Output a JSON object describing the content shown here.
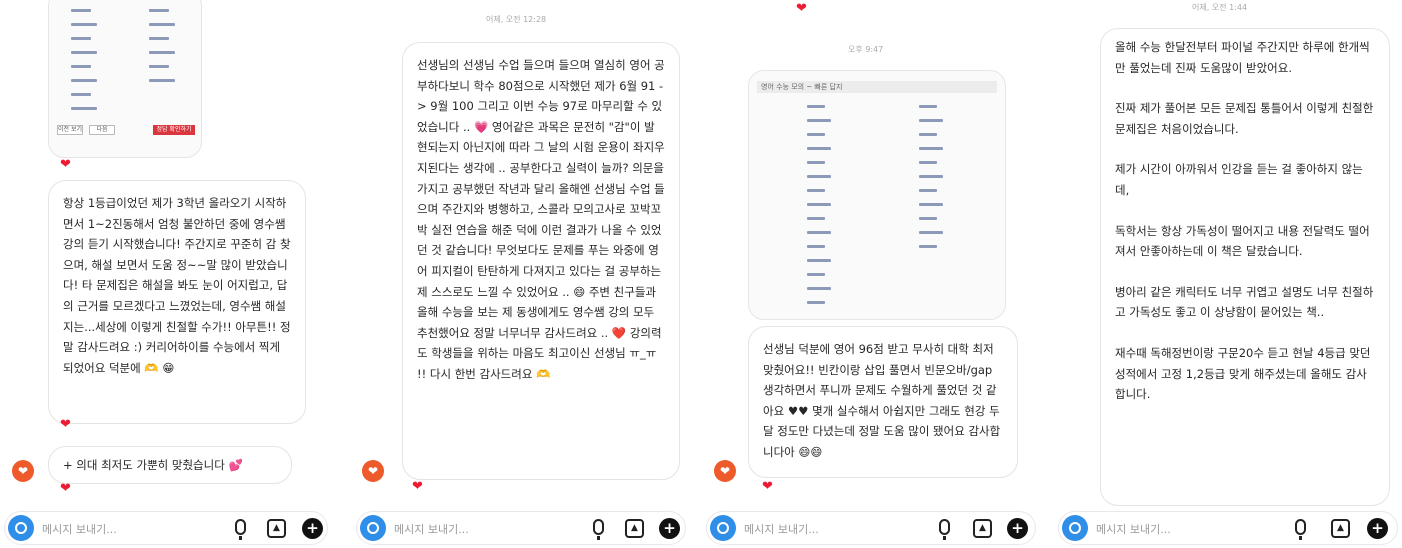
{
  "composer": {
    "placeholder": "메시지 보내기..."
  },
  "icons": {
    "heart": "heart-icon",
    "camera": "camera-icon",
    "mic": "microphone-icon",
    "gallery": "image-icon",
    "plus": "plus-circle-icon",
    "reaction": "heart-reaction-icon"
  },
  "colors": {
    "reaction_button": "#ee5a2a",
    "heart": "#ed1c33",
    "camera": "#2f8fe8"
  },
  "panel1": {
    "card": {
      "btn_a": "이전 보기",
      "btn_b": "다음",
      "btn_red": "정답 확인하기"
    },
    "msg1": "항상 1등급이었던 제가 3학년 올라오기 시작하면서 1~2진동해서 엄청 불안하던 중에 영수쌤 강의 듣기 시작했습니다! 주간지로 꾸준히 감 찾으며, 해설 보면서 도움 정~~말 많이 받았습니다! 타 문제집은 해설을 봐도 눈이 어지럽고, 답의 근거를 모르겠다고 느꼈었는데, 영수쌤 해설지는...세상에 이렇게 친절할 수가!! 아무튼!! 정말 감사드려요 :) 커리어하이를 수능에서 찍게 되었어요 덕분에 🫶 😁",
    "msg2": "+ 의대 최저도 가뿐히 맞췄습니다 💕"
  },
  "panel2": {
    "timestamp": "어제, 오전 12:28",
    "msg": "선생님의 선생님 수업 들으며 들으며 열심히 영어 공부하다보니 학수 80점으로 시작했던 제가 6월 91 -> 9월 100 그리고 이번 수능 97로 마무리할 수 있었습니다 .. 💗 영어같은 과목은 문전히 \"감\"이 발현되는지 아닌지에 따라 그 날의 시험 운용이 좌지우지된다는 생각에 .. 공부한다고 실력이 늘까? 의문을 가지고 공부했던 작년과 달리 올해엔 선생님 수업 들으며 주간지와 병행하고, 스콜라 모의고사로 꼬박꼬박 실전 연습을 해준 덕에 이런 결과가 나올 수 있었던 것 같습니다! 무엇보다도 문제를 푸는 와중에 영어 피지컬이 탄탄하게 다져지고 있다는 걸 공부하는 제 스스로도 느낄 수 있었어요 .. 😄 주변 친구들과 올해 수능을 보는 제 동생에게도 영수쌤 강의 모두 추천했어요 정말 너무너무 감사드려요 .. ❤️ 강의력도 학생들을 위하는 마음도 최고이신 선생님 ㅠ_ㅠ !! 다시 한번 감사드려요 🫶"
  },
  "panel3": {
    "timestamp": "오후 9:47",
    "card_header": "영어 수능 모의 ~ 빠른 답지",
    "msg": "선생님 덕분에 영어 96점 받고 무사히 대학 최저 맞췄어요!! 빈칸이랑 삽입 풀면서 빈문오바/gap 생각하면서 푸니까 문제도 수월하게 풀었던 것 같아요 ♥♥ 몇개 실수해서 아쉽지만 그래도 현강 두달 정도만 다녔는데 정말 도움 많이 됐어요 감사합니다아 😄😄"
  },
  "panel4": {
    "timestamp": "어제, 오전 1:44",
    "paras": [
      "올해 수능 한달전부터 파이널 주간지만 하루에 한개씩만 풀었는데 진짜 도움많이 받았어요.",
      "진짜 제가 풀어본 모든 문제집 통틀어서 이렇게 친절한 문제집은 처음이었습니다.",
      "제가 시간이 아까워서 인강을 듣는 걸 좋아하지 않는데,",
      "독학서는 항상 가독성이 떨어지고 내용 전달력도 떨어져서 안좋아하는데 이 책은 달랐습니다.",
      "병아리 같은 캐릭터도 너무 귀엽고 설명도 너무 친절하고 가독성도 좋고 이 상냥함이 묻어있는 책..",
      "재수때 독해정번이랑 구문20수 듣고 현날 4등급 맞던 성적에서 고정 1,2등급 맞게 해주셨는데 올해도 감사합니다."
    ]
  }
}
